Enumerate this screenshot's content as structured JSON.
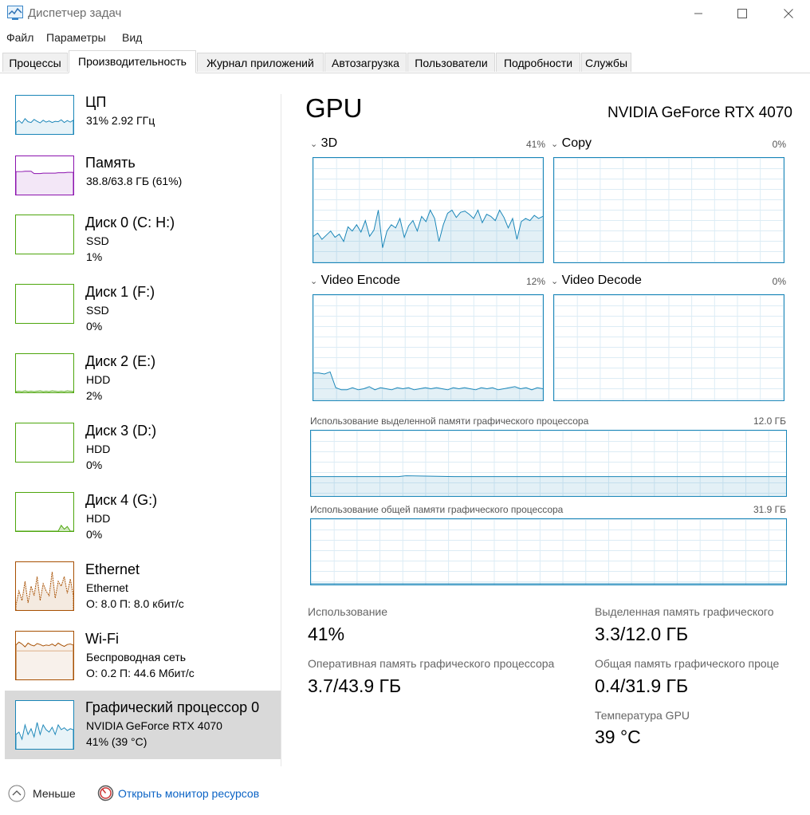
{
  "window": {
    "title": "Диспетчер задач"
  },
  "menu": [
    "Файл",
    "Параметры",
    "Вид"
  ],
  "tabs": [
    "Процессы",
    "Производительность",
    "Журнал приложений",
    "Автозагрузка",
    "Пользователи",
    "Подробности",
    "Службы"
  ],
  "active_tab": "Производительность",
  "sidebar": {
    "items": [
      {
        "title": "ЦП",
        "line1": "31%  2.92 ГГц",
        "line2": ""
      },
      {
        "title": "Память",
        "line1": "38.8/63.8 ГБ (61%)",
        "line2": ""
      },
      {
        "title": "Диск 0 (C: H:)",
        "line1": "SSD",
        "line2": "1%"
      },
      {
        "title": "Диск 1 (F:)",
        "line1": "SSD",
        "line2": "0%"
      },
      {
        "title": "Диск 2 (E:)",
        "line1": "HDD",
        "line2": "2%"
      },
      {
        "title": "Диск 3 (D:)",
        "line1": "HDD",
        "line2": "0%"
      },
      {
        "title": "Диск 4 (G:)",
        "line1": "HDD",
        "line2": "0%"
      },
      {
        "title": "Ethernet",
        "line1": "Ethernet",
        "line2": "О: 8.0  П: 8.0 кбит/с"
      },
      {
        "title": "Wi-Fi",
        "line1": "Беспроводная сеть",
        "line2": "О: 0.2  П: 44.6 Мбит/с"
      },
      {
        "title": "Графический процессор 0",
        "line1": "NVIDIA GeForce RTX 4070",
        "line2": "41% (39 °C)"
      }
    ],
    "selected_index": 9
  },
  "main": {
    "heading": "GPU",
    "model": "NVIDIA GeForce RTX 4070",
    "engines": [
      {
        "label": "3D",
        "percent": "41%"
      },
      {
        "label": "Copy",
        "percent": "0%"
      },
      {
        "label": "Video Encode",
        "percent": "12%"
      },
      {
        "label": "Video Decode",
        "percent": "0%"
      }
    ],
    "dedicated_memory": {
      "label": "Использование выделенной памяти графического процессора",
      "max": "12.0 ГБ"
    },
    "shared_memory": {
      "label": "Использование общей памяти графического процессора",
      "max": "31.9 ГБ"
    },
    "stats": {
      "usage": {
        "label": "Использование",
        "value": "41%"
      },
      "dedicated": {
        "label": "Выделенная память графического",
        "value": "3.3/12.0 ГБ"
      },
      "gpu_ram": {
        "label": "Оперативная память графического процессора",
        "value": "3.7/43.9 ГБ"
      },
      "shared": {
        "label": "Общая память графического проце",
        "value": "0.4/31.9 ГБ"
      },
      "temp": {
        "label": "Температура GPU",
        "value": "39 °C"
      }
    }
  },
  "footer": {
    "less": "Меньше",
    "resource_monitor": "Открыть монитор ресурсов"
  },
  "colors": {
    "cpu": "#1a86b8",
    "memory": "#8b12ae",
    "disk": "#4da60c",
    "network": "#a74f01",
    "gpu": "#1a86b8",
    "selected_bg": "#d9d9d9",
    "link": "#0b63c5"
  },
  "graph_samples": {
    "gpu_3d": [
      0.25,
      0.28,
      0.22,
      0.26,
      0.3,
      0.24,
      0.27,
      0.2,
      0.34,
      0.3,
      0.36,
      0.29,
      0.4,
      0.25,
      0.31,
      0.5,
      0.14,
      0.3,
      0.36,
      0.33,
      0.42,
      0.24,
      0.35,
      0.4,
      0.3,
      0.44,
      0.39,
      0.5,
      0.42,
      0.2,
      0.36,
      0.47,
      0.5,
      0.43,
      0.48,
      0.49,
      0.46,
      0.42,
      0.5,
      0.38,
      0.46,
      0.44,
      0.4,
      0.5,
      0.43,
      0.33,
      0.42,
      0.22,
      0.39,
      0.42,
      0.4,
      0.45,
      0.42,
      0.44
    ],
    "video_encode": [
      0.26,
      0.26,
      0.25,
      0.27,
      0.12,
      0.1,
      0.1,
      0.12,
      0.1,
      0.11,
      0.13,
      0.1,
      0.12,
      0.11,
      0.1,
      0.12,
      0.11,
      0.12,
      0.1,
      0.11,
      0.12,
      0.11,
      0.12,
      0.11,
      0.1,
      0.12,
      0.11,
      0.12,
      0.11,
      0.1,
      0.12,
      0.11,
      0.12,
      0.1,
      0.11,
      0.12,
      0.13,
      0.11,
      0.12,
      0.1,
      0.12,
      0.11
    ],
    "cpu_thumb": [
      0.3,
      0.35,
      0.28,
      0.4,
      0.32,
      0.3,
      0.38,
      0.33,
      0.29,
      0.36,
      0.31,
      0.34,
      0.3,
      0.33,
      0.32,
      0.37,
      0.3,
      0.35,
      0.31,
      0.36
    ],
    "gpu_thumb": [
      0.3,
      0.35,
      0.2,
      0.5,
      0.3,
      0.42,
      0.25,
      0.55,
      0.3,
      0.5,
      0.4,
      0.35,
      0.45,
      0.3,
      0.5,
      0.4,
      0.44,
      0.38,
      0.42,
      0.4
    ],
    "disk4_thumb": [
      0,
      0,
      0,
      0,
      0,
      0,
      0,
      0,
      0,
      0,
      0,
      0,
      0,
      0,
      0,
      0.15,
      0.05,
      0.12,
      0,
      0
    ],
    "disk2_thumb": [
      0.02,
      0.03,
      0.02,
      0.04,
      0.02,
      0.03,
      0.02,
      0.03,
      0.04,
      0.02,
      0.03,
      0.02,
      0.04,
      0.03,
      0.02,
      0.03,
      0.02,
      0.04,
      0.03,
      0.02
    ],
    "eth_thumb": [
      0.1,
      0.4,
      0.2,
      0.6,
      0.15,
      0.5,
      0.3,
      0.7,
      0.2,
      0.55,
      0.4,
      0.3,
      0.8,
      0.25,
      0.6,
      0.5,
      0.7,
      0.35,
      0.65,
      0.3
    ],
    "wifi_thumb": [
      0.72,
      0.78,
      0.74,
      0.68,
      0.76,
      0.72,
      0.7,
      0.75,
      0.73,
      0.7,
      0.72,
      0.71,
      0.74,
      0.7,
      0.76,
      0.72,
      0.69,
      0.73,
      0.74,
      0.72
    ],
    "mem_thumb": [
      0.6,
      0.6,
      0.6,
      0.61,
      0.61,
      0.61,
      0.55,
      0.55,
      0.55,
      0.56,
      0.56,
      0.56,
      0.56,
      0.56,
      0.57,
      0.57,
      0.57,
      0.58,
      0.58,
      0.58
    ]
  }
}
